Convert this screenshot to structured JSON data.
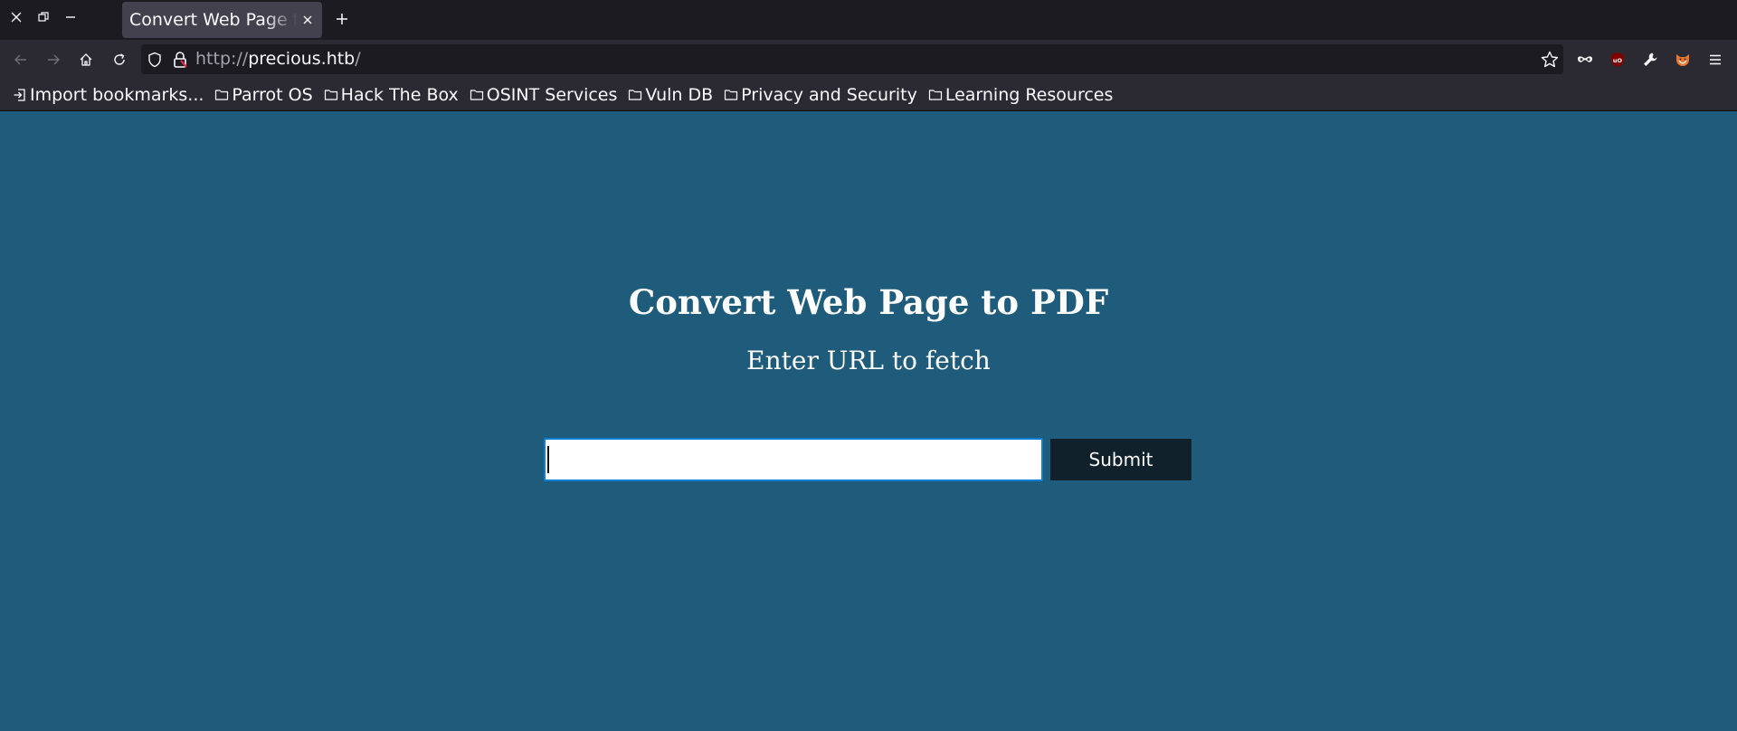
{
  "browser": {
    "tab": {
      "title": "Convert Web Page to PDF"
    },
    "address": {
      "scheme": "http://",
      "host": "precious.htb",
      "path": "/"
    },
    "bookmarks": [
      {
        "label": "Import bookmarks...",
        "icon": "import-icon"
      },
      {
        "label": "Parrot OS",
        "icon": "folder-icon"
      },
      {
        "label": "Hack The Box",
        "icon": "folder-icon"
      },
      {
        "label": "OSINT Services",
        "icon": "folder-icon"
      },
      {
        "label": "Vuln DB",
        "icon": "folder-icon"
      },
      {
        "label": "Privacy and Security",
        "icon": "folder-icon"
      },
      {
        "label": "Learning Resources",
        "icon": "folder-icon"
      }
    ],
    "extensions": [
      "incognito-mask-icon",
      "ublock-origin-icon",
      "wrench-icon",
      "foxyproxy-icon",
      "hamburger-menu-icon"
    ]
  },
  "page": {
    "heading": "Convert Web Page to PDF",
    "subheading": "Enter URL to fetch",
    "url_input": {
      "value": "",
      "placeholder": ""
    },
    "submit_label": "Submit"
  },
  "colors": {
    "page_background": "#1f5c7c",
    "submit_background": "#10212c",
    "input_focus_border": "#0b7fd6",
    "browser_chrome": "#2b2a33",
    "tab_strip": "#1c1b22"
  }
}
